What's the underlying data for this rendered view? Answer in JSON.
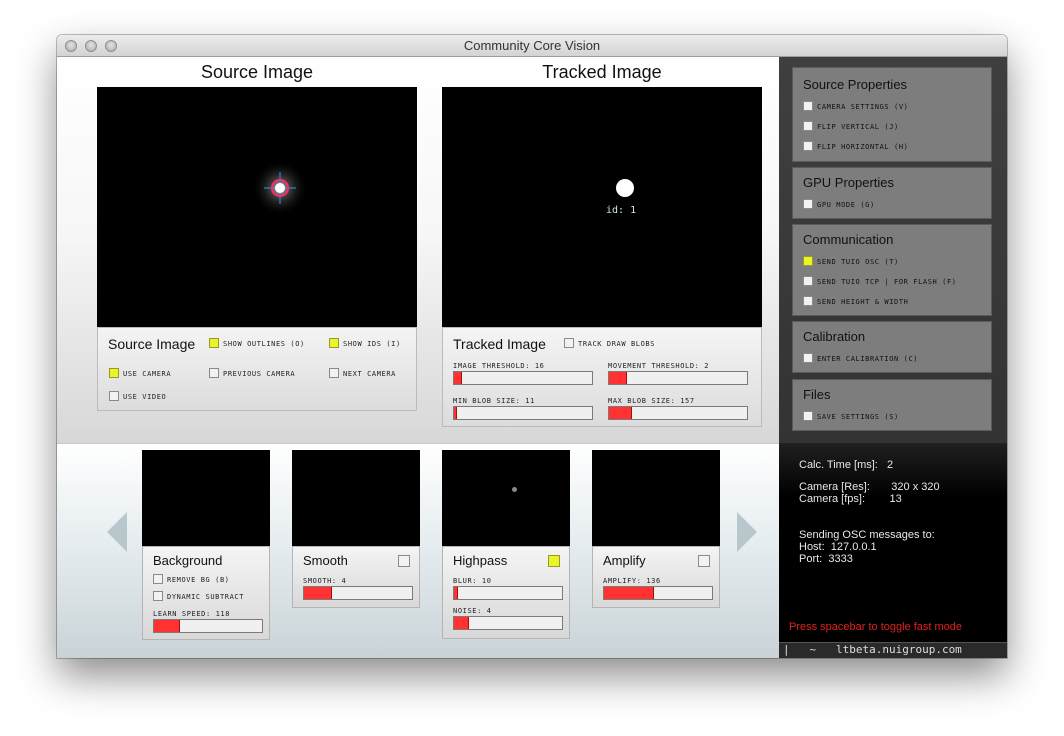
{
  "window": {
    "title": "Community Core Vision"
  },
  "source": {
    "title": "Source Image",
    "panel_label": "Source Image",
    "show_outlines": "SHOW OUTLINES (O)",
    "show_ids": "SHOW IDS (I)",
    "use_camera": "USE CAMERA",
    "previous_camera": "PREVIOUS CAMERA",
    "next_camera": "NEXT CAMERA",
    "use_video": "USE VIDEO"
  },
  "tracked": {
    "title": "Tracked Image",
    "panel_label": "Tracked Image",
    "blob_id": "id: 1",
    "track_draw_blobs": "TRACK DRAW BLOBS",
    "image_threshold": "IMAGE THRESHOLD: 16",
    "movement_threshold": "MOVEMENT THRESHOLD: 2",
    "min_blob_size": "MIN BLOB SIZE: 11",
    "max_blob_size": "MAX BLOB SIZE: 157",
    "levels": {
      "image_threshold": 0.06,
      "movement_threshold": 0.13,
      "min_blob_size": 0.02,
      "max_blob_size": 0.17
    }
  },
  "sidebar": {
    "source_properties": {
      "title": "Source  Properties",
      "camera_settings": "CAMERA SETTINGS (V)",
      "flip_vertical": "FLIP VERTICAL (J)",
      "flip_horizontal": "FLIP HORIZONTAL (H)"
    },
    "gpu_properties": {
      "title": "GPU  Properties",
      "gpu_mode": "GPU MODE (G)"
    },
    "communication": {
      "title": "Communication",
      "send_tuio_osc": "SEND TUIO OSC (T)",
      "send_tuio_tcp": "SEND TUIO TCP | FOR FLASH (F)",
      "send_height_width": "SEND HEIGHT & WIDTH"
    },
    "calibration": {
      "title": "Calibration",
      "enter_calibration": "ENTER CALIBRATION (C)"
    },
    "files": {
      "title": "Files",
      "save_settings": "SAVE SETTINGS (S)"
    }
  },
  "filters": {
    "background": {
      "title": "Background",
      "remove_bg": "REMOVE BG (B)",
      "dynamic_subtract": "DYNAMIC SUBTRACT",
      "learn_speed": "LEARN SPEED: 118",
      "learn_speed_level": 0.24
    },
    "smooth": {
      "title": "Smooth",
      "smooth": "SMOOTH: 4",
      "smooth_level": 0.26
    },
    "highpass": {
      "title": "Highpass",
      "blur": "BLUR: 10",
      "blur_level": 0.04,
      "noise": "NOISE: 4",
      "noise_level": 0.14
    },
    "amplify": {
      "title": "Amplify",
      "amplify": "AMPLIFY: 136",
      "amplify_level": 0.46
    }
  },
  "status": {
    "calc_time": "Calc. Time [ms]:   2",
    "camera_res": "Camera [Res]:       320 x 320",
    "camera_fps": "Camera [fps]:        13",
    "sending": "Sending OSC messages to:",
    "host": "Host:  127.0.0.1",
    "port": "Port:  3333",
    "hint": "Press spacebar to toggle fast mode",
    "footer": "|   ~   ltbeta.nuigroup.com"
  },
  "colors": {
    "accent_red": "#ff3131",
    "check_on": "#e8f52a",
    "sidebar_bg": "#3a3a3a"
  }
}
